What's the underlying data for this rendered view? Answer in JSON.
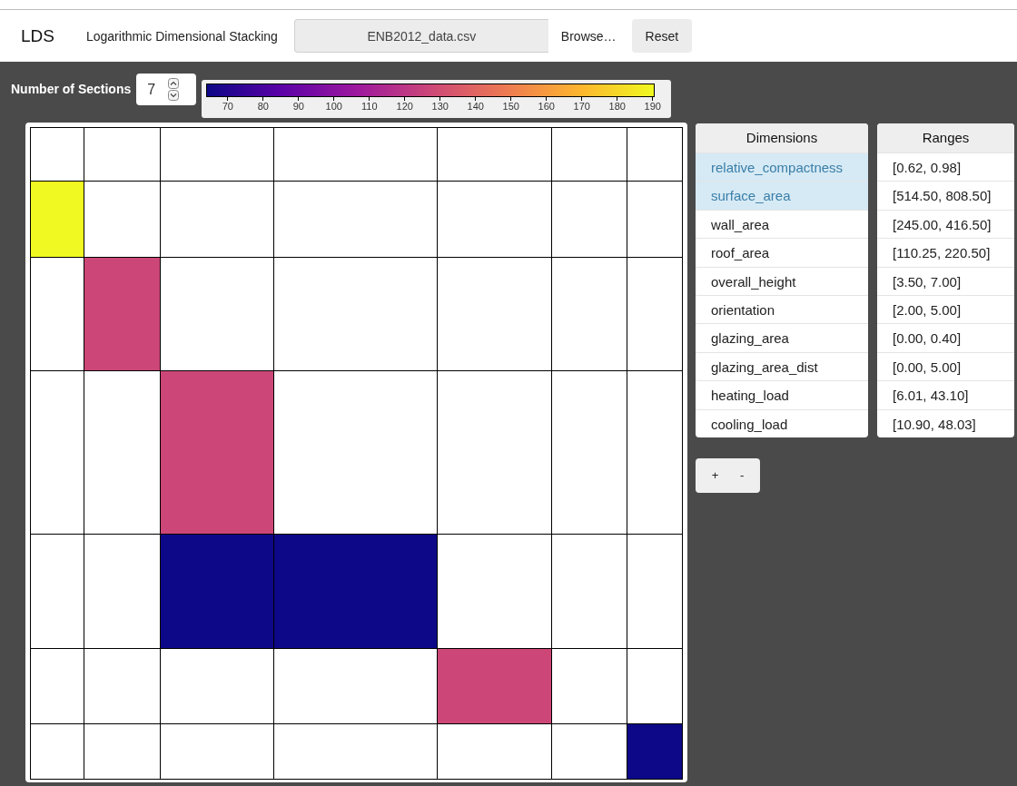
{
  "header": {
    "logo": "LDS",
    "title": "Logarithmic Dimensional Stacking",
    "file_field": {
      "value": "ENB2012_data.csv"
    },
    "browse_label": "Browse…",
    "reset_button": "Reset"
  },
  "sections": {
    "label": "Number of Sections",
    "value": "7"
  },
  "color_scale": {
    "ticks": [
      "70",
      "80",
      "90",
      "100",
      "110",
      "120",
      "130",
      "140",
      "150",
      "160",
      "170",
      "180",
      "190"
    ]
  },
  "grid": {
    "rows": [
      {
        "cells": [
          {
            "filled": false
          },
          {
            "filled": false
          },
          {
            "filled": false
          },
          {
            "filled": false
          },
          {
            "filled": false
          },
          {
            "filled": false
          },
          {
            "filled": false
          }
        ]
      },
      {
        "cells": [
          {
            "filled": true,
            "color": "#f0f921"
          },
          {
            "filled": false
          },
          {
            "filled": false
          },
          {
            "filled": false
          },
          {
            "filled": false
          },
          {
            "filled": false
          },
          {
            "filled": false
          }
        ]
      },
      {
        "cells": [
          {
            "filled": false
          },
          {
            "filled": true,
            "color": "#cc4778"
          },
          {
            "filled": false
          },
          {
            "filled": false
          },
          {
            "filled": false
          },
          {
            "filled": false
          },
          {
            "filled": false
          }
        ]
      },
      {
        "cells": [
          {
            "filled": false
          },
          {
            "filled": false
          },
          {
            "filled": true,
            "color": "#cc4778"
          },
          {
            "filled": false
          },
          {
            "filled": false
          },
          {
            "filled": false
          },
          {
            "filled": false
          }
        ]
      },
      {
        "cells": [
          {
            "filled": false
          },
          {
            "filled": false
          },
          {
            "filled": true,
            "color": "#0d0887"
          },
          {
            "filled": true,
            "color": "#0d0887"
          },
          {
            "filled": false
          },
          {
            "filled": false
          },
          {
            "filled": false
          }
        ]
      },
      {
        "cells": [
          {
            "filled": false
          },
          {
            "filled": false
          },
          {
            "filled": false
          },
          {
            "filled": false
          },
          {
            "filled": true,
            "color": "#cc4778"
          },
          {
            "filled": false
          },
          {
            "filled": false
          }
        ]
      },
      {
        "cells": [
          {
            "filled": false
          },
          {
            "filled": false
          },
          {
            "filled": false
          },
          {
            "filled": false
          },
          {
            "filled": false
          },
          {
            "filled": false
          },
          {
            "filled": true,
            "color": "#0d0887"
          }
        ]
      }
    ]
  },
  "dimensions_table": {
    "header": "Dimensions",
    "rows": [
      {
        "label": "relative_compactness",
        "selected": true
      },
      {
        "label": "surface_area",
        "selected": true
      },
      {
        "label": "wall_area",
        "selected": false
      },
      {
        "label": "roof_area",
        "selected": false
      },
      {
        "label": "overall_height",
        "selected": false
      },
      {
        "label": "orientation",
        "selected": false
      },
      {
        "label": "glazing_area",
        "selected": false
      },
      {
        "label": "glazing_area_dist",
        "selected": false
      },
      {
        "label": "heating_load",
        "selected": false
      },
      {
        "label": "cooling_load",
        "selected": false
      }
    ]
  },
  "ranges_table": {
    "header": "Ranges",
    "rows": [
      "[0.62, 0.98]",
      "[514.50, 808.50]",
      "[245.00, 416.50]",
      "[110.25, 220.50]",
      "[3.50, 7.00]",
      "[2.00, 5.00]",
      "[0.00, 0.40]",
      "[0.00, 5.00]",
      "[6.01, 43.10]",
      "[10.90, 48.03]"
    ]
  },
  "zoom_buttons": [
    "+",
    "-"
  ]
}
